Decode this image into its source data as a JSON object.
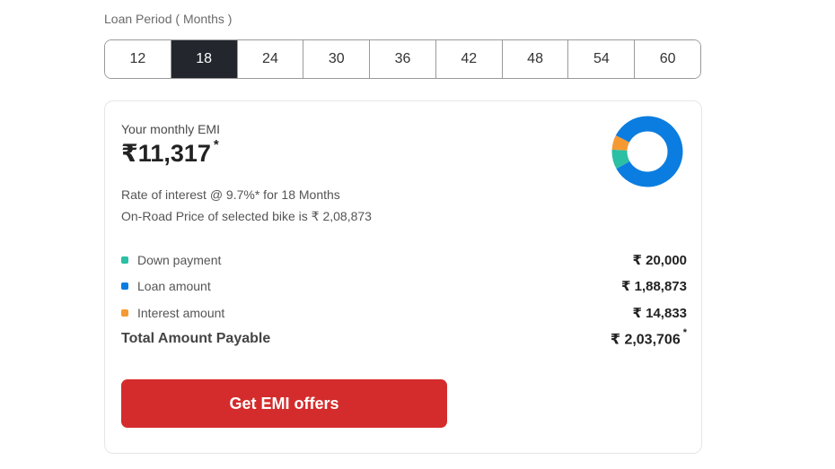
{
  "loan_period": {
    "label": "Loan Period ( Months )",
    "options": [
      "12",
      "18",
      "24",
      "30",
      "36",
      "42",
      "48",
      "54",
      "60"
    ],
    "selected": "18"
  },
  "emi": {
    "title": "Your monthly EMI",
    "currency": "₹",
    "value": "11,317",
    "asterisk": "*",
    "rate_text": "Rate of interest @ 9.7%* for 18 Months",
    "price_text": "On-Road Price of selected bike is ₹ 2,08,873"
  },
  "breakdown": [
    {
      "label": "Down payment",
      "amount": "₹ 20,000",
      "color": "#2bbfa4"
    },
    {
      "label": "Loan amount",
      "amount": "₹ 1,88,873",
      "color": "#0b7de0"
    },
    {
      "label": "Interest amount",
      "amount": "₹ 14,833",
      "color": "#f59a33"
    }
  ],
  "total": {
    "label": "Total Amount Payable",
    "amount": "₹ 2,03,706",
    "asterisk": "*"
  },
  "cta": {
    "label": "Get EMI offers",
    "color": "#d42c2c"
  },
  "donut": {
    "segments": [
      {
        "name": "Loan amount",
        "value": 188873,
        "color": "#0b7de0"
      },
      {
        "name": "Down payment",
        "value": 20000,
        "color": "#2bbfa4"
      },
      {
        "name": "Interest amount",
        "value": 14833,
        "color": "#f59a33"
      }
    ]
  }
}
